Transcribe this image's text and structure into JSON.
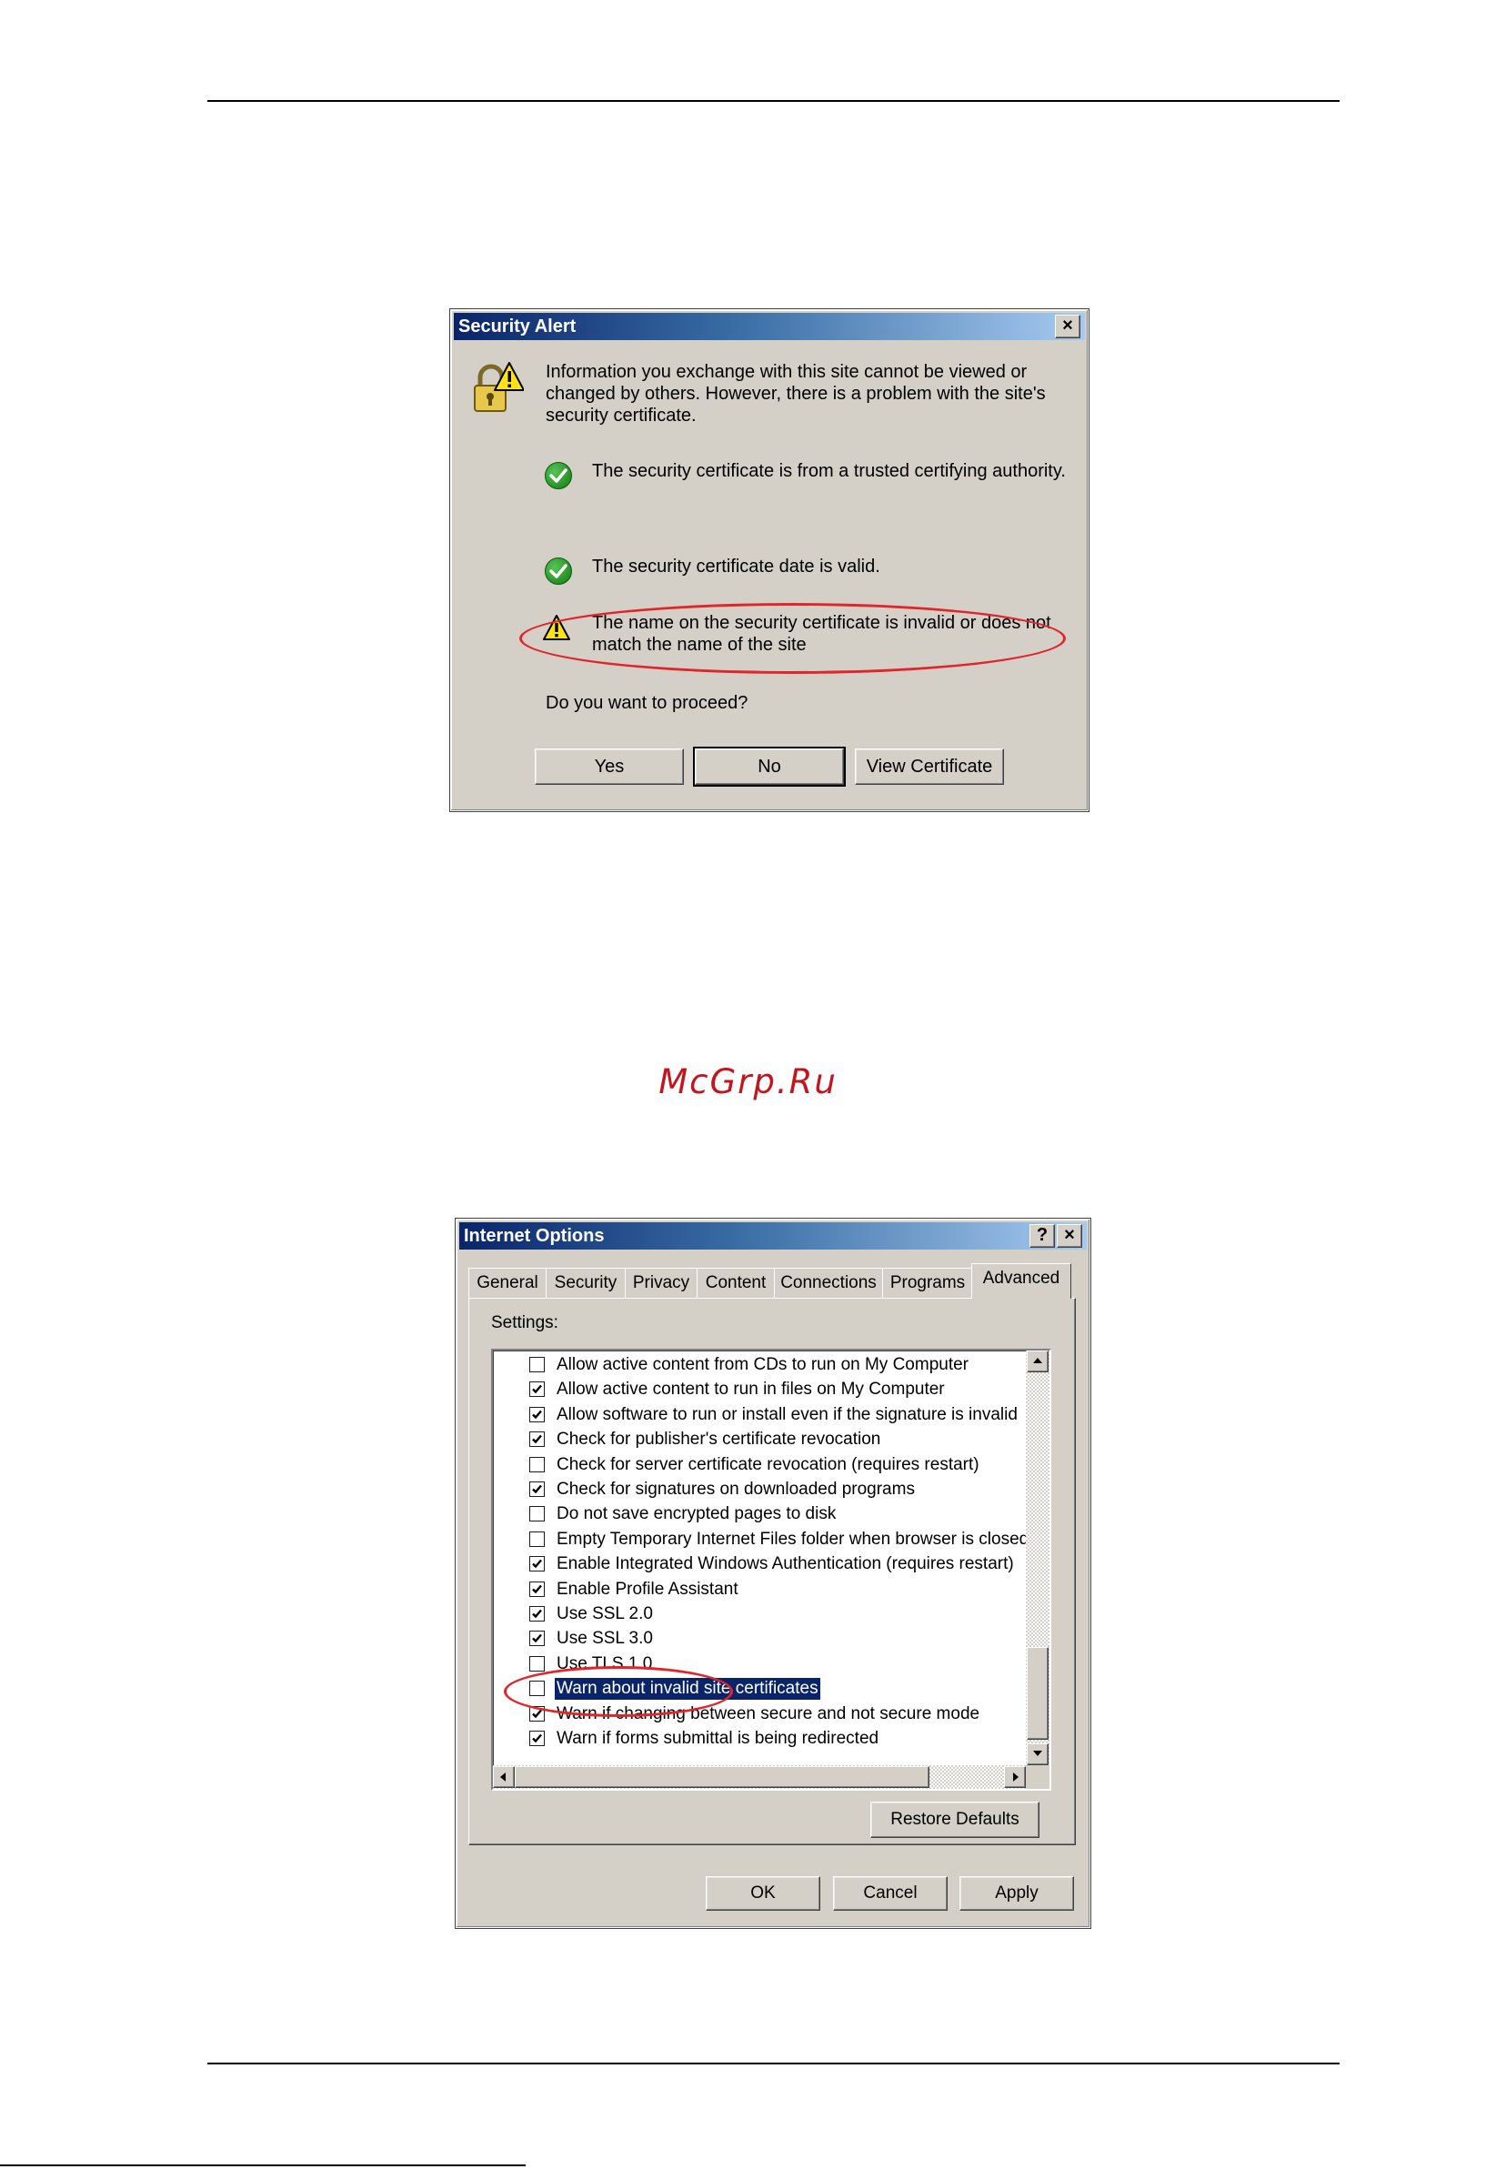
{
  "page": {
    "watermark": "McGrp.Ru"
  },
  "security_alert": {
    "title": "Security Alert",
    "close_label": "×",
    "intro_line1": "Information you exchange with this site cannot be viewed or",
    "intro_line2": "changed by others. However, there is a problem with the site's",
    "intro_line3": "security certificate.",
    "checks": [
      {
        "status": "ok",
        "text": "The security certificate is from a trusted certifying authority."
      },
      {
        "status": "ok",
        "text": "The security certificate date is valid."
      },
      {
        "status": "warning",
        "text_line1": "The name on the security certificate is invalid or does not",
        "text_line2": "match the name of the site"
      }
    ],
    "question": "Do you want to proceed?",
    "buttons": {
      "yes": "Yes",
      "no": "No",
      "view_certificate": "View Certificate"
    }
  },
  "internet_options": {
    "title": "Internet Options",
    "help_label": "?",
    "close_label": "×",
    "tabs": [
      "General",
      "Security",
      "Privacy",
      "Content",
      "Connections",
      "Programs",
      "Advanced"
    ],
    "active_tab": "Advanced",
    "settings_label": "Settings:",
    "settings": [
      {
        "label": "Allow active content from CDs to run on My Computer",
        "checked": false
      },
      {
        "label": "Allow active content to run in files on My Computer",
        "checked": true
      },
      {
        "label": "Allow software to run or install even if the signature is invalid",
        "checked": true
      },
      {
        "label": "Check for publisher's certificate revocation",
        "checked": true
      },
      {
        "label": "Check for server certificate revocation (requires restart)",
        "checked": false
      },
      {
        "label": "Check for signatures on downloaded programs",
        "checked": true
      },
      {
        "label": "Do not save encrypted pages to disk",
        "checked": false
      },
      {
        "label": "Empty Temporary Internet Files folder when browser is closed",
        "checked": false
      },
      {
        "label": "Enable Integrated Windows Authentication (requires restart)",
        "checked": true
      },
      {
        "label": "Enable Profile Assistant",
        "checked": true
      },
      {
        "label": "Use SSL 2.0",
        "checked": true
      },
      {
        "label": "Use SSL 3.0",
        "checked": true
      },
      {
        "label": "Use TLS 1.0",
        "checked": false
      },
      {
        "label": "Warn about invalid site certificates",
        "checked": false,
        "selected": true
      },
      {
        "label": "Warn if changing between secure and not secure mode",
        "checked": true
      },
      {
        "label": "Warn if forms submittal is being redirected",
        "checked": true
      }
    ],
    "restore_defaults": "Restore Defaults",
    "buttons": {
      "ok": "OK",
      "cancel": "Cancel",
      "apply": "Apply"
    },
    "colors": {
      "highlight": "#e0252b",
      "selection": "#0a246a",
      "face": "#d4d0c8"
    }
  }
}
